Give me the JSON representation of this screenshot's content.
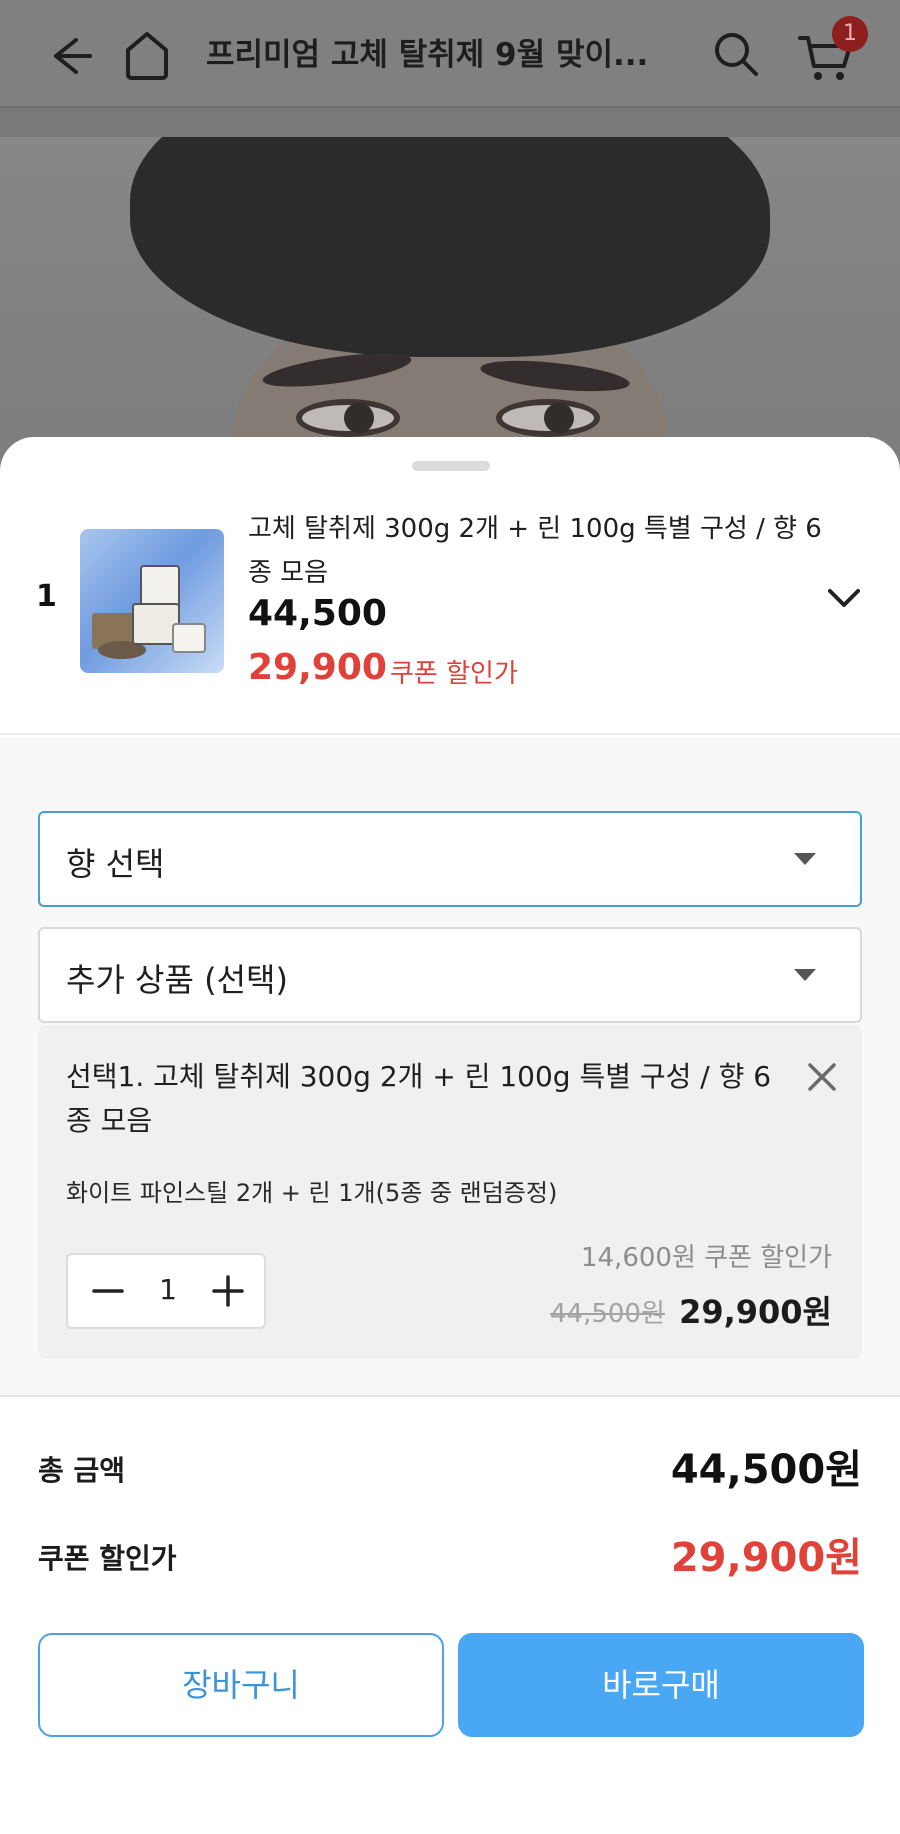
{
  "header": {
    "title": "프리미엄 고체 탈취제 9월 맞이...",
    "cart_count": "1"
  },
  "product": {
    "index": "1",
    "name": "고체 탈취제 300g 2개 + 린 100g 특별 구성 / 향 6종 모음",
    "price": "44,500",
    "coupon_price": "29,900",
    "coupon_label": "쿠폰 할인가"
  },
  "options": {
    "scent_select": "향 선택",
    "addon_select": "추가 상품 (선택)"
  },
  "selected": {
    "title": "선택1. 고체 탈취제 300g 2개 + 린 100g 특별 구성 / 향 6종 모음",
    "description": "화이트 파인스틸 2개 + 린 1개(5종 중 랜덤증정)",
    "quantity": "1",
    "discount_text": "14,600원 쿠폰 할인가",
    "original_price": "44,500원",
    "final_price": "29,900원"
  },
  "summary": {
    "total_label": "총 금액",
    "total_value": "44,500원",
    "coupon_label": "쿠폰 할인가",
    "coupon_value": "29,900원"
  },
  "buttons": {
    "cart_label": "장바구니",
    "buy_label": "바로구매"
  },
  "colors": {
    "accent_blue": "#4aa7f3",
    "sale_red": "#e0423a"
  }
}
